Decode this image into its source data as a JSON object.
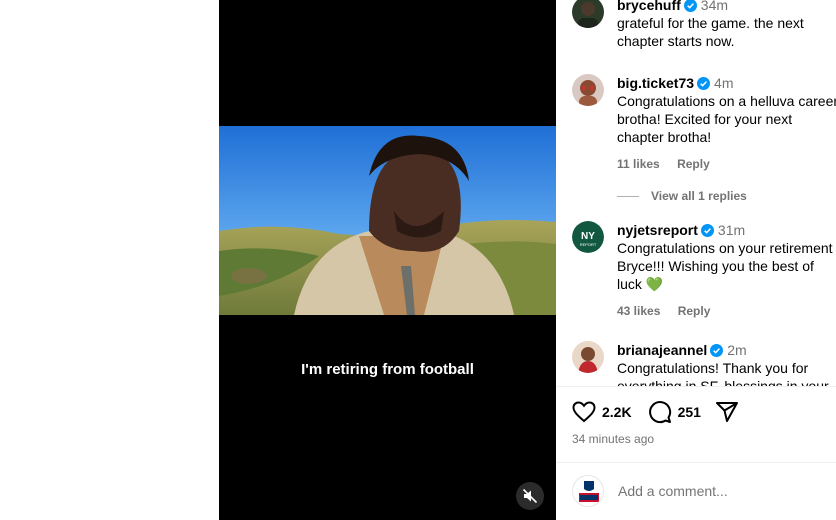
{
  "video": {
    "caption": "I'm retiring from football",
    "mute_icon": "muted-speaker-icon"
  },
  "comments": [
    {
      "username": "brycehuff",
      "verified": true,
      "time": "34m",
      "text": "grateful for the game. the next chapter starts now.",
      "likes": "",
      "reply": ""
    },
    {
      "username": "big.ticket73",
      "verified": true,
      "time": "4m",
      "text": "Congratulations on a helluva career brotha! Excited for your next chapter brotha!",
      "likes": "11 likes",
      "reply": "Reply"
    },
    {
      "username": "nyjetsreport",
      "verified": true,
      "time": "31m",
      "text": "Congratulations on your retirement Bryce!!! Wishing you the best of luck 💚",
      "likes": "43 likes",
      "reply": "Reply"
    },
    {
      "username": "brianajeannel",
      "verified": true,
      "time": "2m",
      "text": "Congratulations! Thank you for everything in SF, blessings in your",
      "likes": "",
      "reply": ""
    }
  ],
  "view_replies": "View all 1 replies",
  "actions": {
    "like_count": "2.2K",
    "comment_count": "251",
    "like_icon": "heart-icon",
    "comment_icon": "comment-bubble-icon",
    "share_icon": "paper-plane-icon"
  },
  "posted": "34 minutes ago",
  "add_comment": {
    "placeholder": "Add a comment..."
  },
  "colors": {
    "verified": "#0095f6",
    "muted_text": "#737373",
    "jets_green": "#125740"
  }
}
